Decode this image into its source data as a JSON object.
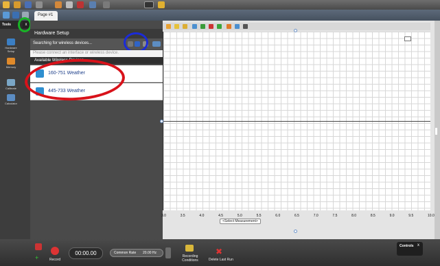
{
  "tabs": {
    "page_tab": "Page #1"
  },
  "tools": {
    "header": "Tools",
    "close_label": "x",
    "items": [
      {
        "label": "Hardware Setup",
        "icon": "hardware-icon"
      },
      {
        "label": "Memory",
        "icon": "memory-icon"
      },
      {
        "label": "Calibrate",
        "icon": "calibrate-icon"
      },
      {
        "label": "Calculator",
        "icon": "calculator-icon"
      }
    ]
  },
  "hardware_setup": {
    "title": "Hardware Setup",
    "status": "Searching for wireless devices...",
    "hint": "Please connect an interface or wireless device.",
    "list_title": "Available Wireless Devices",
    "devices": [
      {
        "label": "160-751 Weather"
      },
      {
        "label": "445-733 Weather"
      }
    ]
  },
  "graph": {
    "x_ticks": [
      "3.0",
      "3.5",
      "4.0",
      "4.5",
      "5.0",
      "5.5",
      "6.0",
      "6.5",
      "7.0",
      "7.5",
      "8.0",
      "8.5",
      "9.0",
      "9.5",
      "10.0"
    ],
    "select_measurement": "<Select Measurement>"
  },
  "bottom": {
    "record_label": "Record",
    "timer": "00:00.00",
    "rate_mode": "Common Rate",
    "rate_value": "20.00 Hz",
    "recording_conditions": "Recording Conditions",
    "delete_last_run": "Delete Last Run",
    "controls_label": "Controls",
    "controls_close": "x"
  },
  "colors": {
    "highlight_green": "#18b526",
    "highlight_blue": "#1b2bd8",
    "highlight_red": "#d8121a"
  }
}
